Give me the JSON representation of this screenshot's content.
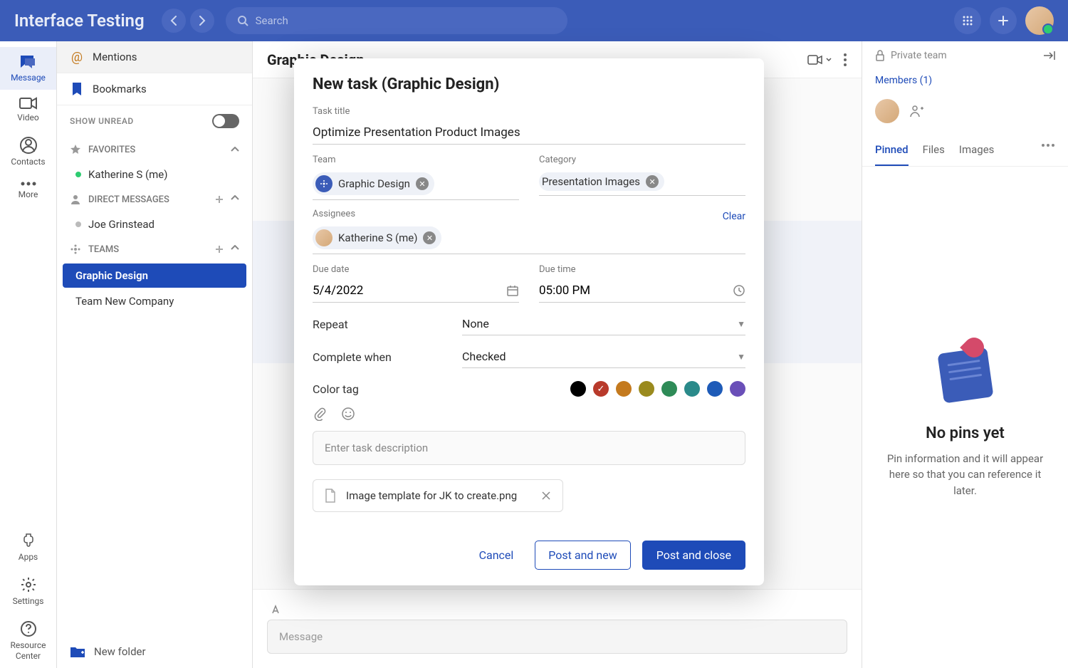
{
  "app": {
    "title": "Interface Testing",
    "search_placeholder": "Search"
  },
  "rail": {
    "items": [
      {
        "label": "Message",
        "active": true
      },
      {
        "label": "Video"
      },
      {
        "label": "Contacts"
      },
      {
        "label": "More"
      }
    ],
    "bottom": [
      {
        "label": "Apps"
      },
      {
        "label": "Settings"
      },
      {
        "label": "Resource Center"
      }
    ]
  },
  "sidebar": {
    "mentions": "Mentions",
    "bookmarks": "Bookmarks",
    "show_unread": "SHOW UNREAD",
    "favorites_hdr": "FAVORITES",
    "favorites": [
      {
        "name": "Katherine S (me)",
        "online": true
      }
    ],
    "dm_hdr": "DIRECT MESSAGES",
    "dms": [
      {
        "name": "Joe Grinstead",
        "online": false
      }
    ],
    "teams_hdr": "TEAMS",
    "teams": [
      {
        "name": "Graphic Design",
        "active": true
      },
      {
        "name": "Team New Company",
        "active": false
      }
    ],
    "new_folder": "New folder"
  },
  "main": {
    "title": "Graphic Design",
    "message_placeholder": "Message"
  },
  "right": {
    "private_label": "Private team",
    "members_link": "Members (1)",
    "tabs": {
      "pinned": "Pinned",
      "files": "Files",
      "images": "Images"
    },
    "empty_title": "No pins yet",
    "empty_desc": "Pin information and it will appear here so that you can reference it later."
  },
  "modal": {
    "title": "New task (Graphic Design)",
    "labels": {
      "task_title": "Task title",
      "team": "Team",
      "category": "Category",
      "assignees": "Assignees",
      "clear": "Clear",
      "due_date": "Due date",
      "due_time": "Due time",
      "repeat": "Repeat",
      "complete_when": "Complete when",
      "color_tag": "Color tag",
      "description_placeholder": "Enter task description"
    },
    "values": {
      "task_title": "Optimize Presentation Product Images",
      "team_chip": "Graphic Design",
      "category_chip": "Presentation Images",
      "assignee_chip": "Katherine S (me)",
      "due_date": "5/4/2022",
      "due_time": "05:00 PM",
      "repeat": "None",
      "complete_when": "Checked"
    },
    "colors": [
      "#000000",
      "#b83a2b",
      "#c47a1e",
      "#9a8a1e",
      "#2e8b57",
      "#2a8a8a",
      "#1e5bb8",
      "#6a4fb8"
    ],
    "selected_color": 1,
    "attachment": "Image template for JK to create.png",
    "buttons": {
      "cancel": "Cancel",
      "post_new": "Post and new",
      "post_close": "Post and close"
    }
  }
}
